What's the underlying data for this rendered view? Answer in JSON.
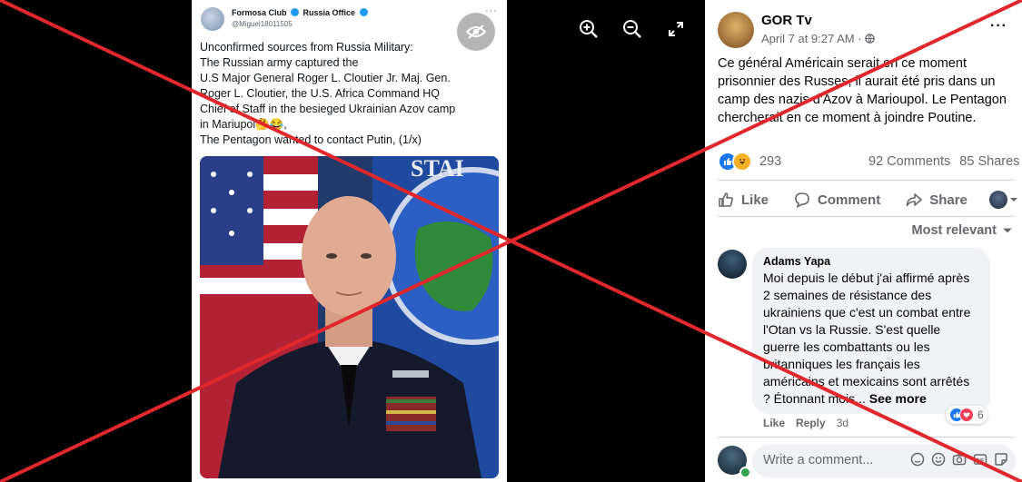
{
  "viewer": {
    "tweet": {
      "name_a": "Formosa Club",
      "name_b": "Russia Office",
      "handle": "@Miguel18011505",
      "more": "···",
      "lines": [
        "Unconfirmed sources from Russia Military:",
        "The Russian army captured the",
        "U.S Major General Roger L. Cloutier Jr. Maj. Gen.",
        "Roger L. Cloutier, the U.S. Africa Command HQ",
        "Chief of Staff in the besieged Ukrainian Azov camp",
        "in Mariupol🤔😂,",
        "The Pentagon wanted to contact Putin, (1/x)"
      ],
      "photo_banner": "STAI"
    },
    "controls": {
      "zoom_in": "zoom-in-icon",
      "zoom_out": "zoom-out-icon",
      "fullscreen": "fullscreen-icon",
      "hide": "eye-slash-icon"
    }
  },
  "post": {
    "author": "GOR Tv",
    "time": "April 7 at 9:27 AM · ",
    "more": "···",
    "text": "Ce général Américain serait en ce moment prisonnier des Russes, il aurait été pris dans un camp des nazis d'Azov à Marioupol. Le Pentagon chercherait en ce moment à joindre Poutine.",
    "reactions_count": "293",
    "comments": "92 Comments",
    "shares": "85 Shares",
    "actions": {
      "like": "Like",
      "comment": "Comment",
      "share": "Share"
    },
    "sort": "Most relevant",
    "comment1": {
      "author": "Adams Yapa",
      "text": "Moi depuis le début j'ai affirmé après 2 semaines de résistance des ukrainiens que c'est un combat entre l'Otan vs la Russie. S'est quelle guerre les combattants ou les britanniques les français les américains et mexicains sont arrêtés ? Étonnant mois... ",
      "see_more": "See more",
      "reaction_count": "6",
      "like": "Like",
      "reply": "Reply",
      "age": "3d"
    },
    "write_placeholder": "Write a comment..."
  },
  "colors": {
    "cross": "#e0272c",
    "fb_blue": "#1877f2",
    "muted": "#65676b"
  }
}
